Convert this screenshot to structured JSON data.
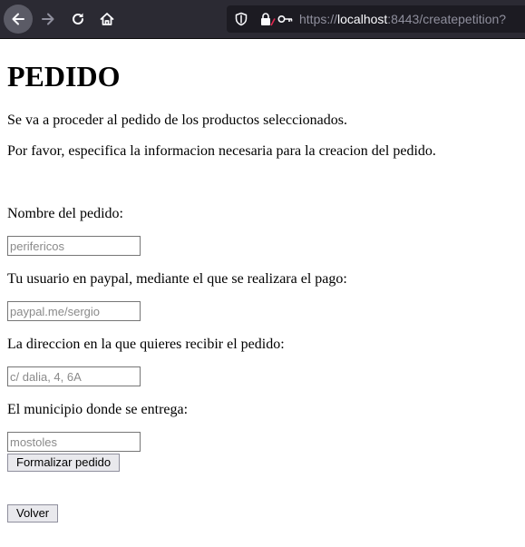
{
  "browser": {
    "url_prefix": "https://",
    "url_host": "localhost",
    "url_rest": ":8443/createpetition?"
  },
  "page": {
    "title": "PEDIDO",
    "intro_1": "Se va a proceder al pedido de los productos seleccionados.",
    "intro_2": "Por favor, especifica la informacion necesaria para la creacion del pedido."
  },
  "form": {
    "name_label": "Nombre del pedido:",
    "name_placeholder": "perifericos",
    "paypal_label": "Tu usuario en paypal, mediante el que se realizara el pago:",
    "paypal_placeholder": "paypal.me/sergio",
    "address_label": "La direccion en la que quieres recibir el pedido:",
    "address_placeholder": "c/ dalia, 4, 6A",
    "city_label": "El municipio donde se entrega:",
    "city_placeholder": "mostoles",
    "submit_label": "Formalizar pedido"
  },
  "back_label": "Volver"
}
